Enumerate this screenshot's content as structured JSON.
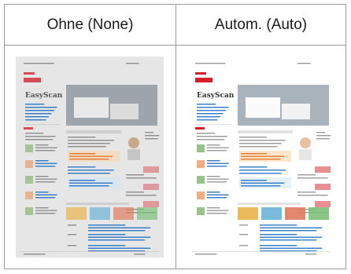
{
  "columns": [
    {
      "label": "Ohne (None)",
      "variant": "none",
      "bg": "#e6e6e6",
      "shade": "#cfcfcf",
      "text": "#8d8d8d"
    },
    {
      "label": "Autom. (Auto)",
      "variant": "auto",
      "bg": "#ffffff",
      "shade": "#e2e2e2",
      "text": "#9a9a9a"
    }
  ],
  "brand": {
    "red": "#d41f2a",
    "blue": "#2f78c8",
    "orange": "#e47a2e",
    "green": "#5a9a3c"
  },
  "thumbnail": {
    "brand_text": "EasyScan"
  }
}
